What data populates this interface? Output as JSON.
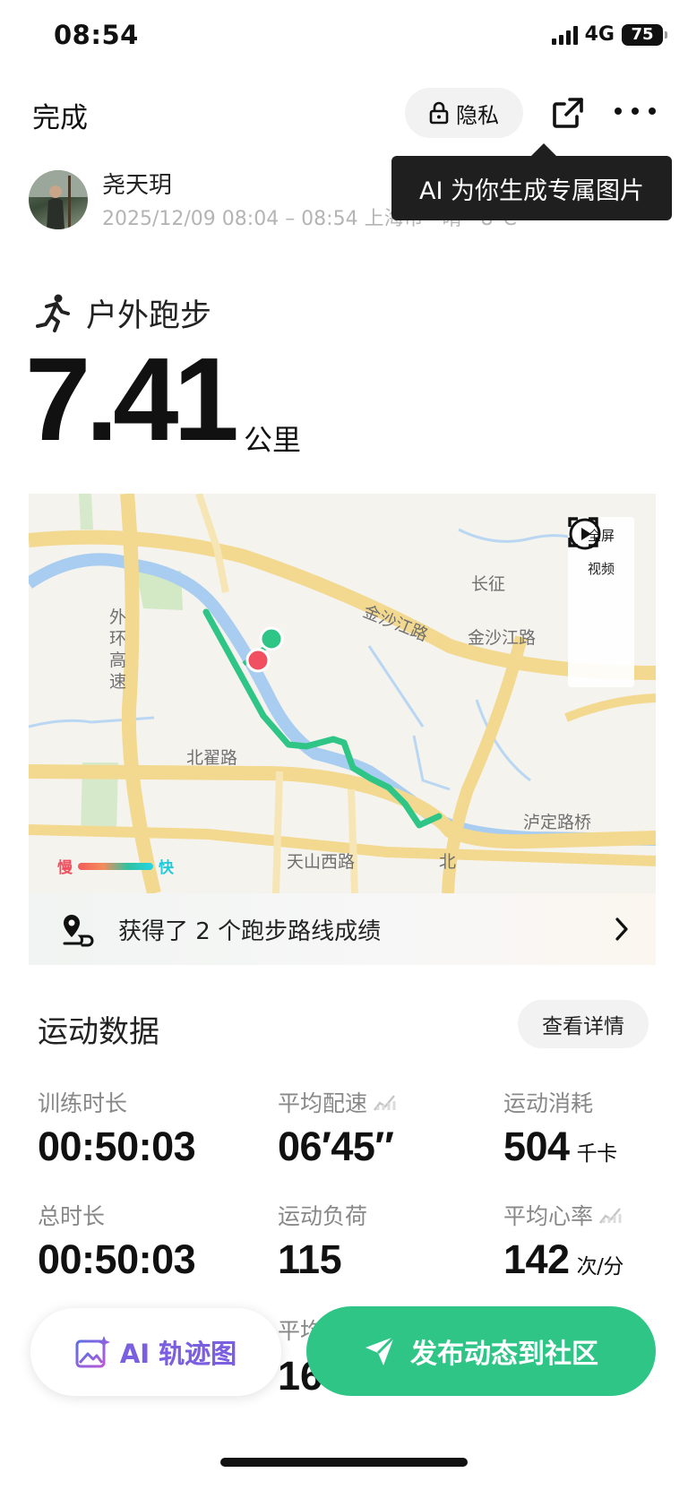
{
  "status_bar": {
    "time": "08:54",
    "network": "4G",
    "battery": "75"
  },
  "top_bar": {
    "done_label": "完成",
    "privacy_label": "隐私"
  },
  "tooltip": {
    "text": "AI 为你生成专属图片"
  },
  "user": {
    "name": "尧天玥",
    "meta": "2025/12/09 08:04 – 08:54 上海市 · 晴 · 8°C"
  },
  "sport": {
    "type": "户外跑步",
    "distance": "7.41",
    "unit": "公里"
  },
  "map": {
    "controls": {
      "fullscreen": "全屏",
      "video": "视频"
    },
    "legend": {
      "slow": "慢",
      "fast": "快"
    },
    "labels": {
      "changzheng": "长征",
      "jinshajiang_road": "金沙江路",
      "jinshajiang_road_2": "金沙江路",
      "outer_ring": "外环高速",
      "beizhai_road": "北翟路",
      "tianshan_west_road": "天山西路",
      "luding_road_bridge": "泸定路桥",
      "bei": "北"
    },
    "colors": {
      "route": "#2ec587",
      "start": "#2ec587",
      "end": "#f0505f",
      "road": "#f6dc95",
      "water": "#a8cdf0",
      "green": "#cfe7c0"
    }
  },
  "achievement": {
    "text": "获得了 2 个跑步路线成绩"
  },
  "data_section": {
    "title": "运动数据",
    "detail_label": "查看详情",
    "stats": [
      {
        "label": "训练时长",
        "value": "00:50:03",
        "unit": ""
      },
      {
        "label": "平均配速",
        "value": "06′45″",
        "unit": ""
      },
      {
        "label": "运动消耗",
        "value": "504",
        "unit": "千卡"
      },
      {
        "label": "总时长",
        "value": "00:50:03",
        "unit": ""
      },
      {
        "label": "运动负荷",
        "value": "115",
        "unit": ""
      },
      {
        "label": "平均心率",
        "value": "142",
        "unit": "次/分"
      }
    ],
    "peek_label": "平均",
    "peek_value": "16"
  },
  "bottom": {
    "ai_label": "AI 轨迹图",
    "publish_label": "发布动态到社区"
  }
}
